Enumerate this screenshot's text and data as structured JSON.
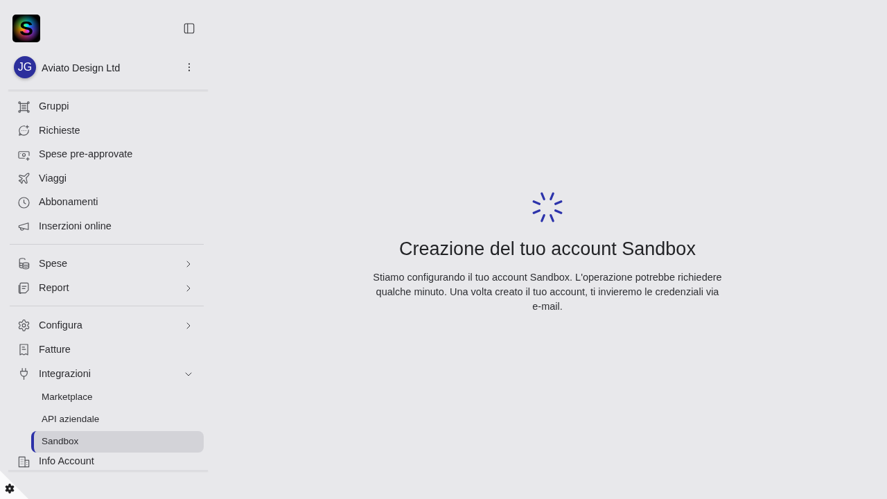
{
  "sidebar": {
    "logo": {
      "text": "S"
    },
    "account": {
      "initials": "JG",
      "name": "Aviato Design Ltd"
    },
    "sections": [
      {
        "items": [
          {
            "label": "Gruppi",
            "selected": false
          },
          {
            "label": "Richieste",
            "selected": false
          },
          {
            "label": "Spese pre-approvate",
            "selected": false
          },
          {
            "label": "Viaggi",
            "selected": false
          },
          {
            "label": "Abbonamenti",
            "selected": false
          },
          {
            "label": "Inserzioni online",
            "selected": false
          }
        ]
      },
      {
        "items": [
          {
            "label": "Spese",
            "selected": false,
            "expanded": false
          },
          {
            "label": "Report",
            "selected": false,
            "expanded": false
          }
        ]
      },
      {
        "items": [
          {
            "label": "Configura",
            "selected": false,
            "expanded": false
          },
          {
            "label": "Fatture",
            "selected": false
          },
          {
            "label": "Integrazioni",
            "selected": false,
            "expanded": true,
            "children": [
              {
                "label": "Marketplace",
                "selected": false
              },
              {
                "label": "API aziendale",
                "selected": false
              },
              {
                "label": "Sandbox",
                "selected": true
              }
            ]
          },
          {
            "label": "Info Account",
            "selected": false
          }
        ]
      }
    ]
  },
  "main": {
    "title": "Creazione del tuo account Sandbox",
    "message": "Stiamo configurando il tuo account Sandbox. L'operazione potrebbe richiedere qualche minuto. Una volta creato il tuo account, ti invieremo le credenziali via e-mail."
  }
}
